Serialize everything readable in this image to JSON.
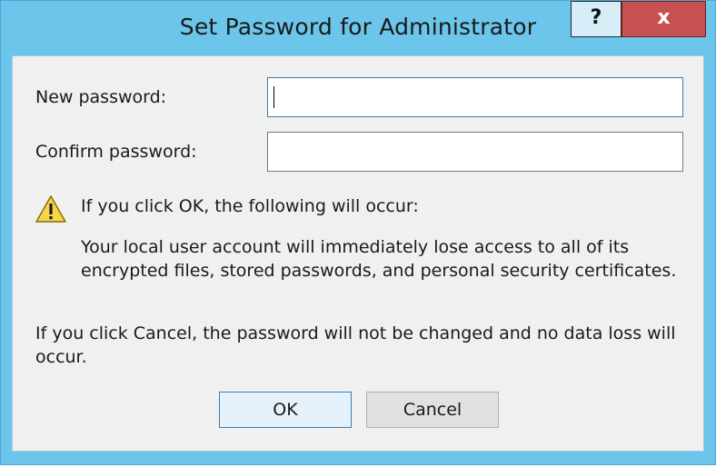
{
  "window": {
    "title": "Set Password for Administrator",
    "help_label": "?",
    "close_label": "x"
  },
  "form": {
    "new_password_label": "New password:",
    "new_password_value": "",
    "confirm_password_label": "Confirm password:",
    "confirm_password_value": ""
  },
  "warning": {
    "icon": "warning-icon",
    "heading": "If you click OK, the following will occur:",
    "body_line1": "Your local user account will immediately lose access to all of its",
    "body_line2": "encrypted files, stored passwords, and personal security certificates."
  },
  "cancel_note": {
    "line1": "If you click Cancel, the password will not be changed and no data loss will",
    "line2": "occur."
  },
  "buttons": {
    "ok_label": "OK",
    "cancel_label": "Cancel"
  },
  "colors": {
    "frame": "#6cc5eb",
    "close_button": "#c75050",
    "dialog_background": "#f0f0f0"
  }
}
